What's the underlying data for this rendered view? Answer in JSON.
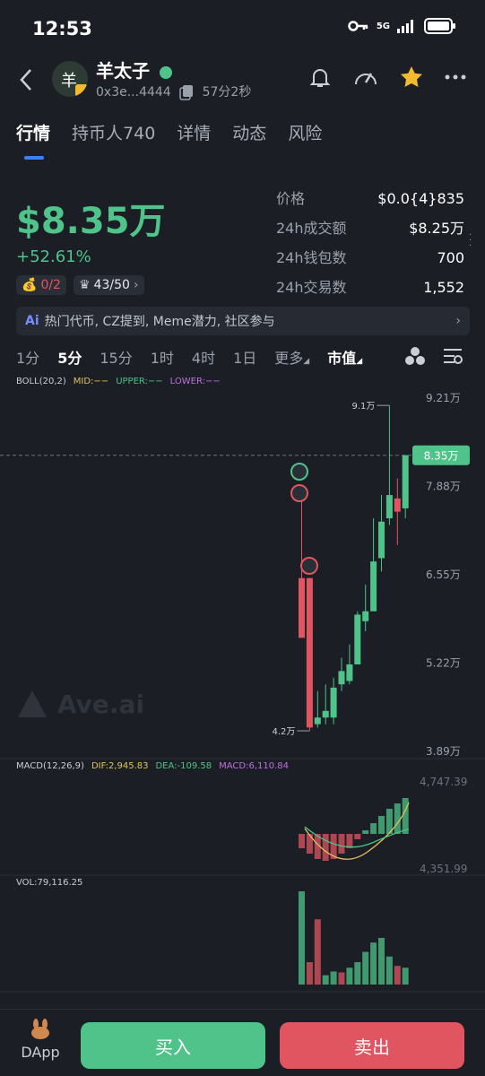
{
  "status": {
    "time": "12:53",
    "network": "5G"
  },
  "header": {
    "title": "羊太子",
    "avatar_char": "羊",
    "address": "0x3e...4444",
    "age": "57分2秒"
  },
  "tabs": [
    {
      "label": "行情"
    },
    {
      "label": "持币人740"
    },
    {
      "label": "详情"
    },
    {
      "label": "动态"
    },
    {
      "label": "风险"
    }
  ],
  "price": {
    "market_cap": "$8.35万",
    "change": "+52.61%"
  },
  "badges": {
    "bag": "0/2",
    "crown": "43/50"
  },
  "stats": [
    {
      "label": "价格",
      "value": "$0.0{4}835"
    },
    {
      "label": "24h成交额",
      "value": "$8.25万"
    },
    {
      "label": "24h钱包数",
      "value": "700"
    },
    {
      "label": "24h交易数",
      "value": "1,552"
    }
  ],
  "tags": "热门代币, CZ提到, Meme潜力, 社区参与",
  "timeframes": [
    "1分",
    "5分",
    "15分",
    "1时",
    "4时",
    "1日",
    "更多",
    "市值"
  ],
  "boll": {
    "name": "BOLL(20,2)",
    "mid": "MID:−−",
    "upper": "UPPER:−−",
    "lower": "LOWER:−−"
  },
  "chart_data": {
    "type": "candlestick",
    "y_ticks": [
      "9.21万",
      "7.88万",
      "6.55万",
      "5.22万",
      "3.89万"
    ],
    "y_tick_values": [
      9.21,
      7.88,
      6.55,
      5.22,
      3.89
    ],
    "high_label": "9.1万",
    "low_label": "4.2万",
    "current_label": "8.35万",
    "current_value": 8.35,
    "candles": [
      {
        "o": 6.5,
        "c": 5.6,
        "h": 7.8,
        "l": 5.6
      },
      {
        "o": 6.5,
        "c": 4.25,
        "h": 6.5,
        "l": 4.2
      },
      {
        "o": 4.3,
        "c": 4.4,
        "h": 4.8,
        "l": 4.25
      },
      {
        "o": 4.4,
        "c": 4.5,
        "h": 4.9,
        "l": 4.3
      },
      {
        "o": 4.4,
        "c": 4.85,
        "h": 5.0,
        "l": 4.3
      },
      {
        "o": 4.9,
        "c": 5.1,
        "h": 5.3,
        "l": 4.8
      },
      {
        "o": 4.95,
        "c": 5.2,
        "h": 5.5,
        "l": 4.9
      },
      {
        "o": 5.2,
        "c": 5.95,
        "h": 6.0,
        "l": 5.2
      },
      {
        "o": 5.85,
        "c": 6.0,
        "h": 6.4,
        "l": 5.7
      },
      {
        "o": 6.0,
        "c": 6.75,
        "h": 7.4,
        "l": 6.0
      },
      {
        "o": 6.8,
        "c": 7.35,
        "h": 7.75,
        "l": 6.6
      },
      {
        "o": 7.4,
        "c": 7.75,
        "h": 9.1,
        "l": 7.3
      },
      {
        "o": 7.7,
        "c": 7.5,
        "h": 8.0,
        "l": 7.0
      },
      {
        "o": 7.55,
        "c": 8.35,
        "h": 8.35,
        "l": 7.4
      }
    ]
  },
  "macd": {
    "name": "MACD(12,26,9)",
    "dif": "DIF:2,945.83",
    "dea": "DEA:-109.58",
    "macd": "MACD:6,110.84",
    "top": "4,747.39",
    "bottom": "4,351.99",
    "bars": [
      -0.4,
      -0.55,
      -0.7,
      -0.75,
      -0.7,
      -0.55,
      -0.4,
      -0.15,
      0.1,
      0.3,
      0.5,
      0.7,
      0.85,
      1.0
    ]
  },
  "vol": {
    "label": "VOL:79,116.25",
    "bars": [
      1.0,
      0.24,
      0.7,
      0.1,
      0.14,
      0.13,
      0.18,
      0.24,
      0.35,
      0.45,
      0.5,
      0.3,
      0.2,
      0.18
    ],
    "colors": [
      "up",
      "down",
      "down",
      "up",
      "up",
      "down",
      "up",
      "up",
      "up",
      "up",
      "up",
      "up",
      "down",
      "up"
    ]
  },
  "bottom": {
    "dapp": "DApp",
    "buy": "买入",
    "sell": "卖出"
  },
  "colors": {
    "up": "#4fc38a",
    "down": "#e05560",
    "bg": "#1b1e25"
  }
}
